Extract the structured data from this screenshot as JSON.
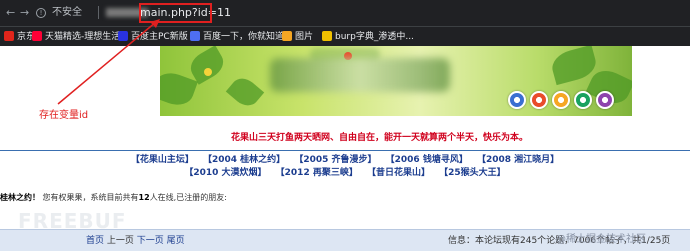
{
  "browser": {
    "nav_back": "←",
    "nav_forward": "→",
    "nav_reload": "C",
    "security_label": "不安全",
    "url_visible": "main.php?id=11",
    "bookmarks": [
      {
        "label": "京东",
        "icon_color": "#e1251b"
      },
      {
        "label": "天猫精选-理想生活...",
        "icon_color": "#ff0036"
      },
      {
        "label": "百度主PC新版",
        "icon_color": "#2932e1"
      },
      {
        "label": "百度一下，你就知道",
        "icon_color": "#4e6ef2"
      },
      {
        "label": "图片",
        "icon_color": "#f5a623"
      },
      {
        "label": "burp字典_渗透中...",
        "icon_color": "#f0c000"
      }
    ]
  },
  "annotation": {
    "label": "存在变量id",
    "color": "#e02020"
  },
  "page": {
    "slogan": "花果山三天打鱼两天晒网、自由自在，能开一天就算两个半天，快乐为本。",
    "forum_links_row1": [
      "【花果山主坛】",
      "【2004 桂林之约】",
      "【2005 齐鲁漫步】",
      "【2006 钱塘寻风】",
      "【2008 湘江晓月】"
    ],
    "forum_links_row2": [
      "【2010 大漠炊烟】",
      "【2012 再聚三峡】",
      "【昔日花果山】",
      "【25猴头大王】"
    ],
    "welcome_lead": "桂林之约！",
    "welcome_text": "您有权果果，系统目前共有",
    "welcome_count": "12",
    "welcome_tail": "人在线,已注册的朋友:",
    "pager": {
      "home": "首页",
      "prev": "上一页",
      "next": "下一页",
      "last": "尾页"
    },
    "info": "信息：本论坛现有245个论题，7006个帖子，共1/25页",
    "watermark": "FREEBUF",
    "credit": "@稀土掘金技术社区"
  },
  "colors": {
    "chrome_bg": "#202124",
    "link_blue": "#1c3d8f",
    "slogan_red": "#d0001d",
    "footer_bg": "#dde6f3"
  }
}
